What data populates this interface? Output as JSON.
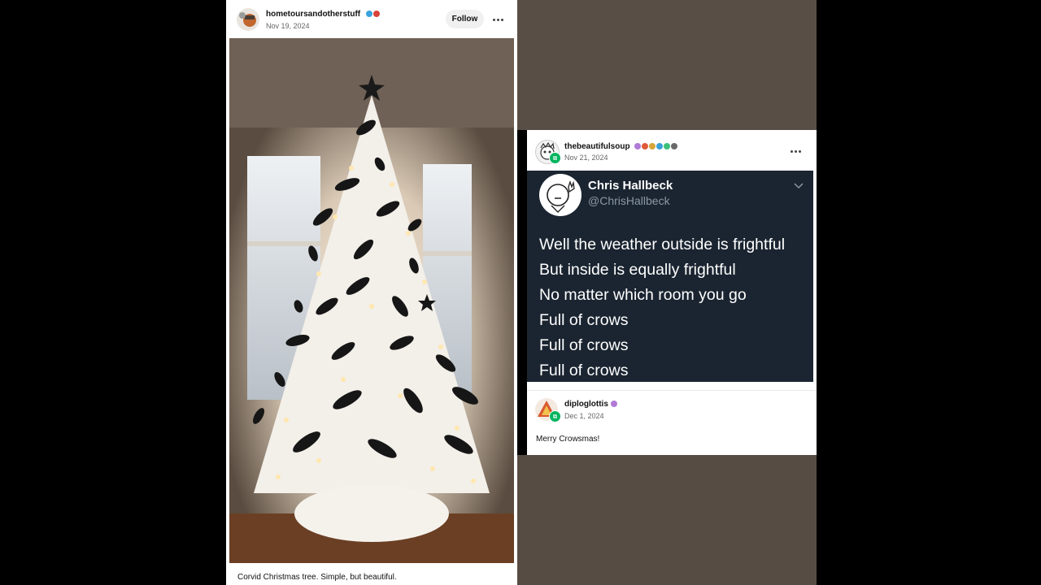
{
  "post_left": {
    "username": "hometoursandotherstuff",
    "date": "Nov 19, 2024",
    "follow_label": "Follow",
    "caption": "Corvid Christmas tree. Simple, but beautiful.",
    "badge_colors": [
      "#3aa3e0",
      "#d9433a"
    ]
  },
  "post_right": {
    "username": "thebeautifulsoup",
    "date": "Nov 21, 2024",
    "badge_colors": [
      "#b07ad6",
      "#e05a3a",
      "#d6a53a",
      "#3aa0d6",
      "#3ac07a",
      "#6a6a6a"
    ],
    "tweet": {
      "name": "Chris Hallbeck",
      "handle": "@ChrisHallbeck",
      "lines": [
        "Well the weather outside is frightful",
        "But inside is equally frightful",
        "No matter which room you go",
        "Full of crows",
        "Full of crows",
        "Full of crows"
      ]
    },
    "reply": {
      "username": "diploglottis",
      "date": "Dec 1, 2024",
      "text": "Merry Crowsmas!",
      "badge_colors": [
        "#b07ad6"
      ]
    }
  },
  "icons": {
    "more": "more-horizontal-icon",
    "reblog": "reblog-icon",
    "chevron": "chevron-down-icon"
  }
}
